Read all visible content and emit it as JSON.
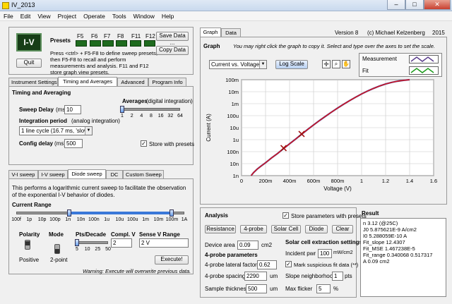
{
  "window": {
    "title": "IV_2013",
    "minimize": "–",
    "maximize": "□",
    "close": "✕"
  },
  "menu": [
    "File",
    "Edit",
    "View",
    "Project",
    "Operate",
    "Tools",
    "Window",
    "Help"
  ],
  "logo": "I-V",
  "quit_label": "Quit",
  "presets": {
    "title": "Presets",
    "keys": [
      "F5",
      "F6",
      "F7",
      "F8",
      "F11",
      "F12"
    ],
    "save_label": "Save Data ...",
    "copy_label": "Copy Data",
    "help": "Press <ctrl> + F5-F8 to define sweep presets, then F5-F8 to recall and perform measurements and analysis.  F11 and F12 store graph view presets."
  },
  "settings_tabs": [
    "Instrument Settings",
    "Timing and Averages",
    "Advanced",
    "Program Info"
  ],
  "timing": {
    "heading": "Timing and Averaging",
    "sweep_delay_label": "Sweep Delay",
    "sweep_delay_unit": "(ms)",
    "sweep_delay_value": "10",
    "integration_label": "Integration period",
    "integration_note": "(analog integration)",
    "integration_value": "1 line cycle (16.7 ms, 'slow')",
    "config_delay_label": "Config delay",
    "config_delay_unit": "(ms)",
    "config_delay_value": "500",
    "averages_label": "Averages",
    "averages_note": "(digital integration)",
    "averages_ticks": [
      "1",
      "2",
      "4",
      "8",
      "16",
      "32",
      "64"
    ],
    "averages_level": 0,
    "store_presets_label": "Store with presets",
    "store_presets_checked": true
  },
  "sweep_tabs": [
    "V-I sweep",
    "I-V sweep",
    "Diode sweep",
    "DC",
    "Custom Sweep"
  ],
  "diode": {
    "description": "This performs a logarithmic current sweep to facilitate the observation of the exponential I-V behavior of diodes.",
    "current_range_label": "Current Range",
    "range_ticks": [
      "100f",
      "1p",
      "10p",
      "100p",
      "1n",
      "10n",
      "100n",
      "1u",
      "10u",
      "100u",
      "1m",
      "10m",
      "100m",
      "1A"
    ],
    "range_low": "1n",
    "range_high": "100m",
    "polarity_label": "Polarity",
    "polarity_value": "Positive",
    "mode_label": "Mode",
    "mode_value": "2-point",
    "pts_label": "Pts/Decade",
    "pts_ticks": [
      "5",
      "10",
      "25",
      "50"
    ],
    "pts_level": 0,
    "compl_label": "Compl. V",
    "compl_value": "2",
    "sense_label": "Sense V Range",
    "sense_value": "2 V",
    "execute_label": "Execute!",
    "warning": "Warning: Execute will overwrite previous data."
  },
  "graph_tabs": [
    "Graph",
    "Data"
  ],
  "version": "Version 8",
  "copyright": "(c)  Michael Kelzenberg",
  "year": "2015",
  "graph": {
    "heading": "Graph",
    "hint": "You may right click the graph to copy it.  Select and type over the axes to set the scale.",
    "plot_select": "Current vs. Voltage",
    "log_scale_label": "Log Scale",
    "legend": [
      "Measurement",
      "Fit"
    ]
  },
  "chart_data": {
    "type": "line",
    "xlabel": "Voltage (V)",
    "ylabel": "Current (A)",
    "x_ticks": [
      "0",
      "200m",
      "400m",
      "600m",
      "800m",
      "1",
      "1.2",
      "1.4",
      "1.6"
    ],
    "y_ticks": [
      "100m",
      "10m",
      "1m",
      "100u",
      "10u",
      "1u",
      "100n",
      "10n",
      "1n"
    ],
    "xlim": [
      0,
      1.6
    ],
    "ylim": [
      1e-09,
      0.1
    ],
    "y_scale": "log",
    "grid": true,
    "series": [
      {
        "name": "Measurement",
        "color": "#5a3c8c",
        "x": [
          0.08,
          0.1,
          0.13,
          0.16,
          0.2,
          0.25,
          0.3,
          0.35,
          0.4,
          0.45,
          0.5,
          0.55,
          0.6,
          0.65,
          0.7,
          0.75,
          0.8,
          0.85,
          0.9,
          0.95,
          1.0,
          1.05,
          1.1,
          1.15,
          1.2,
          1.25,
          1.3,
          1.35,
          1.4
        ],
        "y": [
          1e-09,
          1.8e-09,
          3.5e-09,
          6e-09,
          1.2e-08,
          3e-08,
          7e-08,
          1.8e-07,
          4.5e-07,
          1.1e-06,
          2.8e-06,
          7e-06,
          1.7e-05,
          4e-05,
          9e-05,
          0.0002,
          0.00043,
          0.0009,
          0.0018,
          0.0035,
          0.0065,
          0.0115,
          0.019,
          0.03,
          0.044,
          0.06,
          0.075,
          0.088,
          0.1
        ]
      },
      {
        "name": "Fit",
        "color": "#e01010",
        "x": [
          0.08,
          0.1,
          0.13,
          0.16,
          0.2,
          0.25,
          0.3,
          0.35,
          0.4,
          0.45,
          0.5,
          0.55,
          0.6,
          0.65,
          0.7,
          0.75,
          0.8,
          0.85,
          0.9,
          0.95,
          1.0,
          1.05,
          1.1,
          1.15,
          1.2,
          1.25,
          1.3,
          1.35,
          1.4
        ],
        "y": [
          1e-09,
          1.8e-09,
          3.5e-09,
          6e-09,
          1.2e-08,
          3e-08,
          7e-08,
          1.8e-07,
          4.5e-07,
          1.1e-06,
          2.8e-06,
          7e-06,
          1.7e-05,
          4e-05,
          9e-05,
          0.0002,
          0.00043,
          0.0009,
          0.0018,
          0.0035,
          0.0065,
          0.0115,
          0.019,
          0.03,
          0.044,
          0.06,
          0.075,
          0.088,
          0.1
        ]
      }
    ],
    "markers": [
      {
        "x": 0.35,
        "y": 2e-07
      },
      {
        "x": 0.5,
        "y": 3e-06
      }
    ]
  },
  "analysis": {
    "heading": "Analysis",
    "store_label": "Store parameters with presets",
    "store_checked": true,
    "buttons": [
      "Resistance",
      "4-probe",
      "Solar Cell",
      "Diode",
      "Clear"
    ],
    "device_area_label": "Device area",
    "device_area_value": "0.09",
    "device_area_unit": "cm2",
    "four_probe_heading": "4-probe parameters",
    "lateral_label": "4-probe lateral factor",
    "lateral_value": "0.62",
    "spacing_label": "4-probe spacing",
    "spacing_value": "2290",
    "spacing_unit": "um",
    "thickness_label": "Sample thickness",
    "thickness_value": "500",
    "thickness_unit": "um",
    "solar_heading": "Solar cell extraction settings",
    "incident_label": "Incident pwr",
    "incident_value": "100",
    "incident_unit": "mW/cm2",
    "mark_label": "Mark suspicious fit data (**)",
    "mark_checked": true,
    "slope_label": "Slope neighborhood",
    "slope_value": "1",
    "slope_unit": "pts",
    "flicker_label": "Max flicker",
    "flicker_value": "5",
    "flicker_unit": "%"
  },
  "result": {
    "heading": "Result",
    "lines": [
      "n 3.12 (@25C)",
      "J0 5.875621E-9 A/cm2",
      "I0 5.288059E-10 A",
      "Fit_slope 12.4307",
      "Fit_MSE 1.467238E-5",
      "Fit_range 0.340068 0.517317",
      "A 0.09 cm2"
    ]
  }
}
